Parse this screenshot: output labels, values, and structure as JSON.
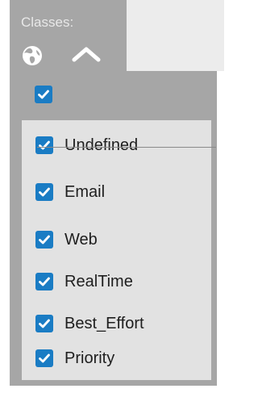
{
  "header": {
    "title": "Classes:"
  },
  "icons": {
    "globe": "globe-icon",
    "collapse": "chevron-up-icon",
    "check": "checkmark-icon"
  },
  "colors": {
    "panel_bg": "#a6a6a6",
    "list_bg": "#e2e2e2",
    "checkbox_accent": "#1a7cc4"
  },
  "select_all": {
    "checked": true
  },
  "classes": [
    {
      "label": "Undefined",
      "checked": true
    },
    {
      "label": "Email",
      "checked": true
    },
    {
      "label": "Web",
      "checked": true
    },
    {
      "label": "RealTime",
      "checked": true
    },
    {
      "label": "Best_Effort",
      "checked": true
    },
    {
      "label": "Priority",
      "checked": true
    }
  ]
}
